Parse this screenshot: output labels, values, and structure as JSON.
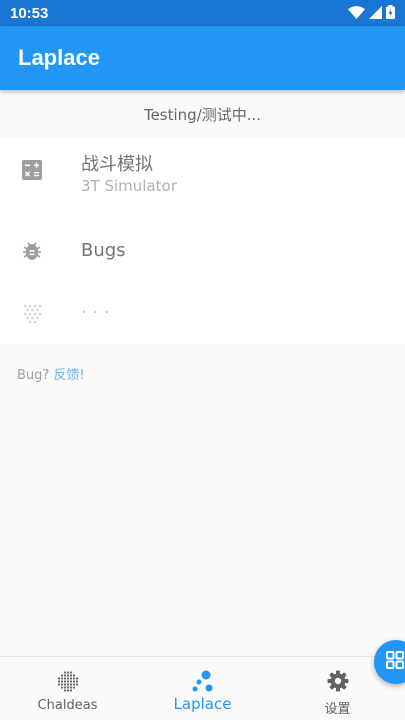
{
  "status_bar": {
    "time": "10:53",
    "icons": [
      "wifi-icon",
      "signal-icon",
      "battery-icon"
    ]
  },
  "app_bar": {
    "title": "Laplace"
  },
  "banner": {
    "text": "Testing/测试中..."
  },
  "list": {
    "items": [
      {
        "icon": "calculator-icon",
        "title": "战斗模拟",
        "subtitle": "3T Simulator"
      },
      {
        "icon": "bug-icon",
        "title": "Bugs"
      },
      {
        "icon": "dots-grid-icon",
        "title": "· · ·"
      }
    ]
  },
  "feedback": {
    "prefix": "Bug? ",
    "link": "反馈!"
  },
  "bottom_nav": {
    "items": [
      {
        "icon": "chaldeas-icon",
        "label": "Chaldeas"
      },
      {
        "icon": "laplace-icon",
        "label": "Laplace",
        "active": true
      },
      {
        "icon": "gear-icon",
        "label": "设置"
      }
    ]
  },
  "fab": {
    "icon": "grid-icon"
  },
  "colors": {
    "status_bar": "#1976d2",
    "primary": "#2196f3",
    "background": "#fafafa",
    "link": "#64b5f6"
  }
}
